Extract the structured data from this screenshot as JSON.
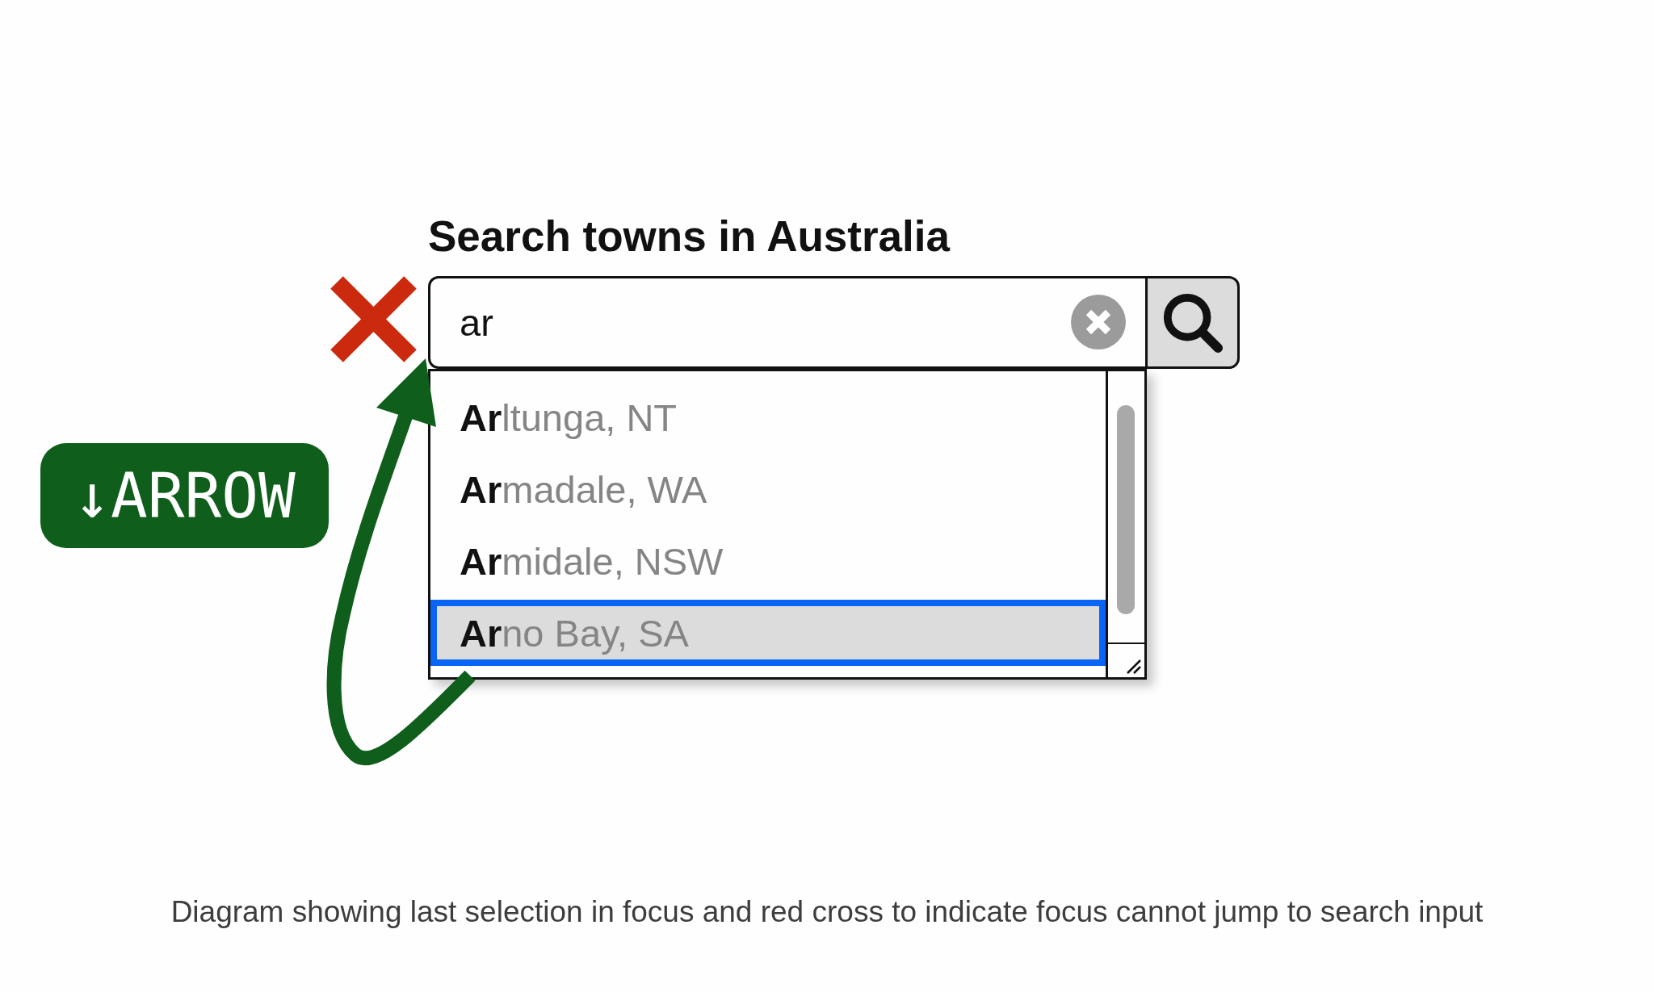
{
  "title": "Search towns in Australia",
  "search": {
    "value": "ar"
  },
  "suggestions": [
    {
      "label": "**Ar**ltunga, NT",
      "selected": false
    },
    {
      "label": "**Ar**madale, WA",
      "selected": false
    },
    {
      "label": "**Ar**midale, NSW",
      "selected": false
    },
    {
      "label": "**Ar**no Bay, SA",
      "selected": true
    }
  ],
  "key_badge": {
    "label": "↓ARROW"
  },
  "caption": "Diagram showing last selection in focus and red cross to indicate focus cannot jump to search input"
}
